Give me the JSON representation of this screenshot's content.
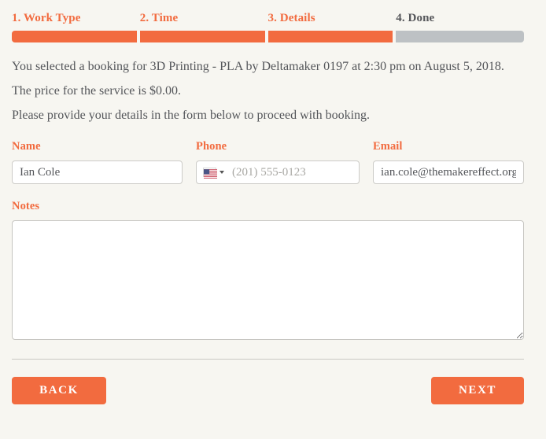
{
  "theme": {
    "accent": "#f26b3f",
    "inactive_bar": "#bdc1c4",
    "background": "#f7f6f1",
    "text": "#54565a"
  },
  "steps": [
    {
      "label": "1. Work Type",
      "state": "active"
    },
    {
      "label": "2. Time",
      "state": "active"
    },
    {
      "label": "3. Details",
      "state": "active"
    },
    {
      "label": "4. Done",
      "state": "inactive"
    }
  ],
  "summary": {
    "line1": "You selected a booking for 3D Printing - PLA by Deltamaker 0197 at 2:30 pm on August 5, 2018.",
    "line2": "The price for the service is $0.00.",
    "line3": "Please provide your details in the form below to proceed with booking."
  },
  "form": {
    "name": {
      "label": "Name",
      "value": "Ian Cole",
      "placeholder": ""
    },
    "phone": {
      "label": "Phone",
      "value": "",
      "placeholder": "(201) 555-0123",
      "country_flag": "us-flag-icon"
    },
    "email": {
      "label": "Email",
      "value": "ian.cole@themakereffect.org",
      "placeholder": ""
    },
    "notes": {
      "label": "Notes",
      "value": "",
      "placeholder": ""
    }
  },
  "buttons": {
    "back": "BACK",
    "next": "NEXT"
  }
}
